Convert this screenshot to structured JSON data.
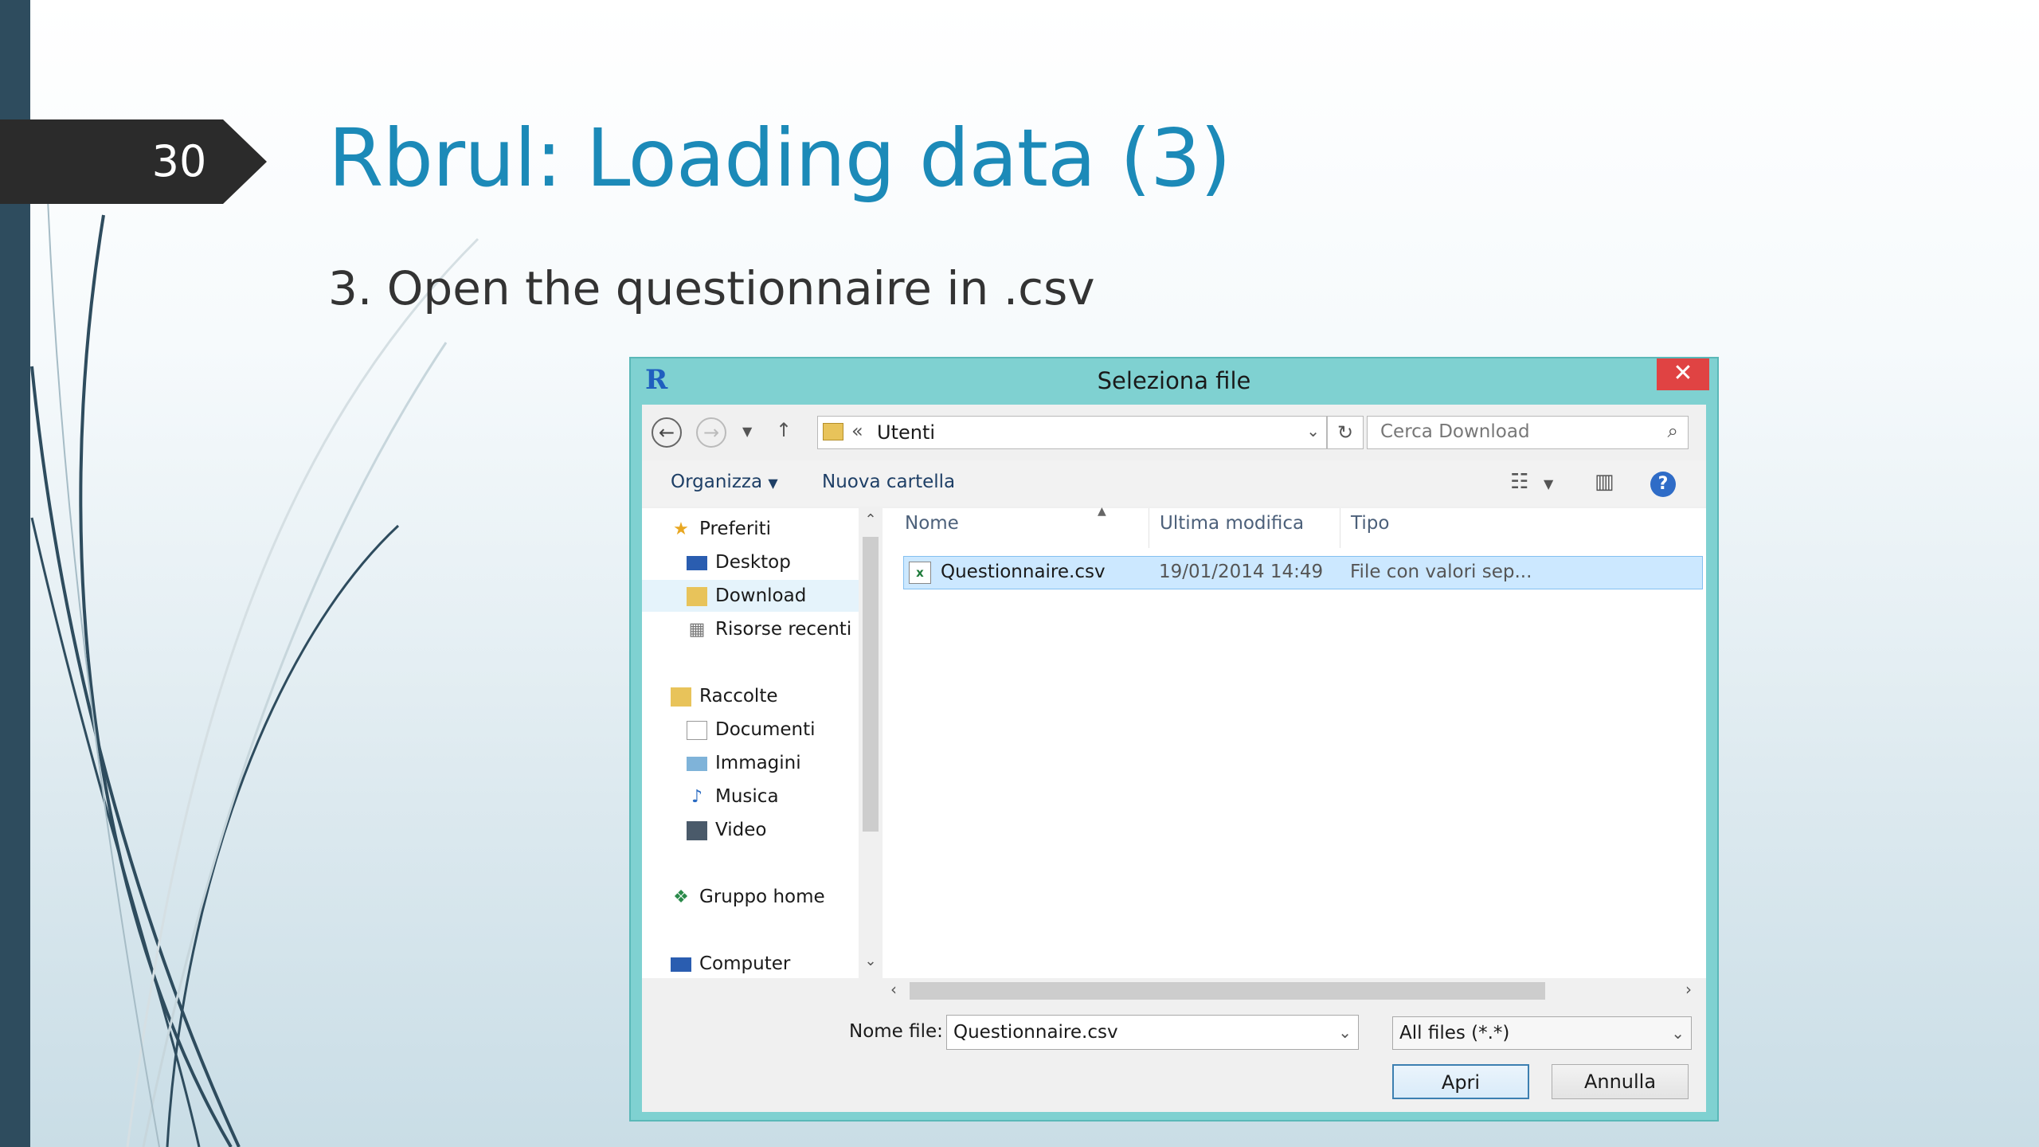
{
  "slide": {
    "number": "30",
    "title": "Rbrul: Loading data (3)",
    "bullet": "3. Open the questionnaire in .csv"
  },
  "dialog": {
    "title": "Seleziona file",
    "address": "Utenti",
    "search_placeholder": "Cerca Download",
    "toolbar": {
      "organize": "Organizza",
      "new_folder": "Nuova cartella"
    },
    "nav": {
      "favorites": "Preferiti",
      "desktop": "Desktop",
      "download": "Download",
      "recent": "Risorse recenti",
      "libraries": "Raccolte",
      "documents": "Documenti",
      "pictures": "Immagini",
      "music": "Musica",
      "video": "Video",
      "homegroup": "Gruppo home",
      "computer": "Computer"
    },
    "columns": {
      "name": "Nome",
      "modified": "Ultima modifica",
      "type": "Tipo"
    },
    "files": [
      {
        "name": "Questionnaire.csv",
        "modified": "19/01/2014 14:49",
        "type": "File con valori sep..."
      }
    ],
    "filename_label": "Nome file:",
    "filename_value": "Questionnaire.csv",
    "filetype": "All files (*.*)",
    "open_button": "Apri",
    "cancel_button": "Annulla",
    "accent_color": "#7fd1d1"
  }
}
